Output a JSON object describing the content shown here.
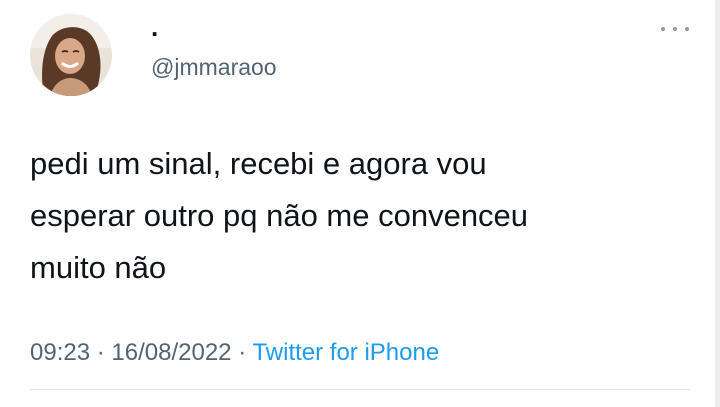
{
  "tweet": {
    "display_name": ".",
    "handle": "@jmmaraoo",
    "text": "pedi um sinal, recebi e agora vou\nesperar outro pq não me convenceu\nmuito não",
    "time": "09:23",
    "separator": "·",
    "date": "16/08/2022",
    "source": "Twitter for iPhone"
  },
  "icons": {
    "avatar": "profile-photo",
    "more": "more-options-icon"
  },
  "colors": {
    "text": "#0f1419",
    "muted": "#536471",
    "link": "#1d9bf0"
  }
}
